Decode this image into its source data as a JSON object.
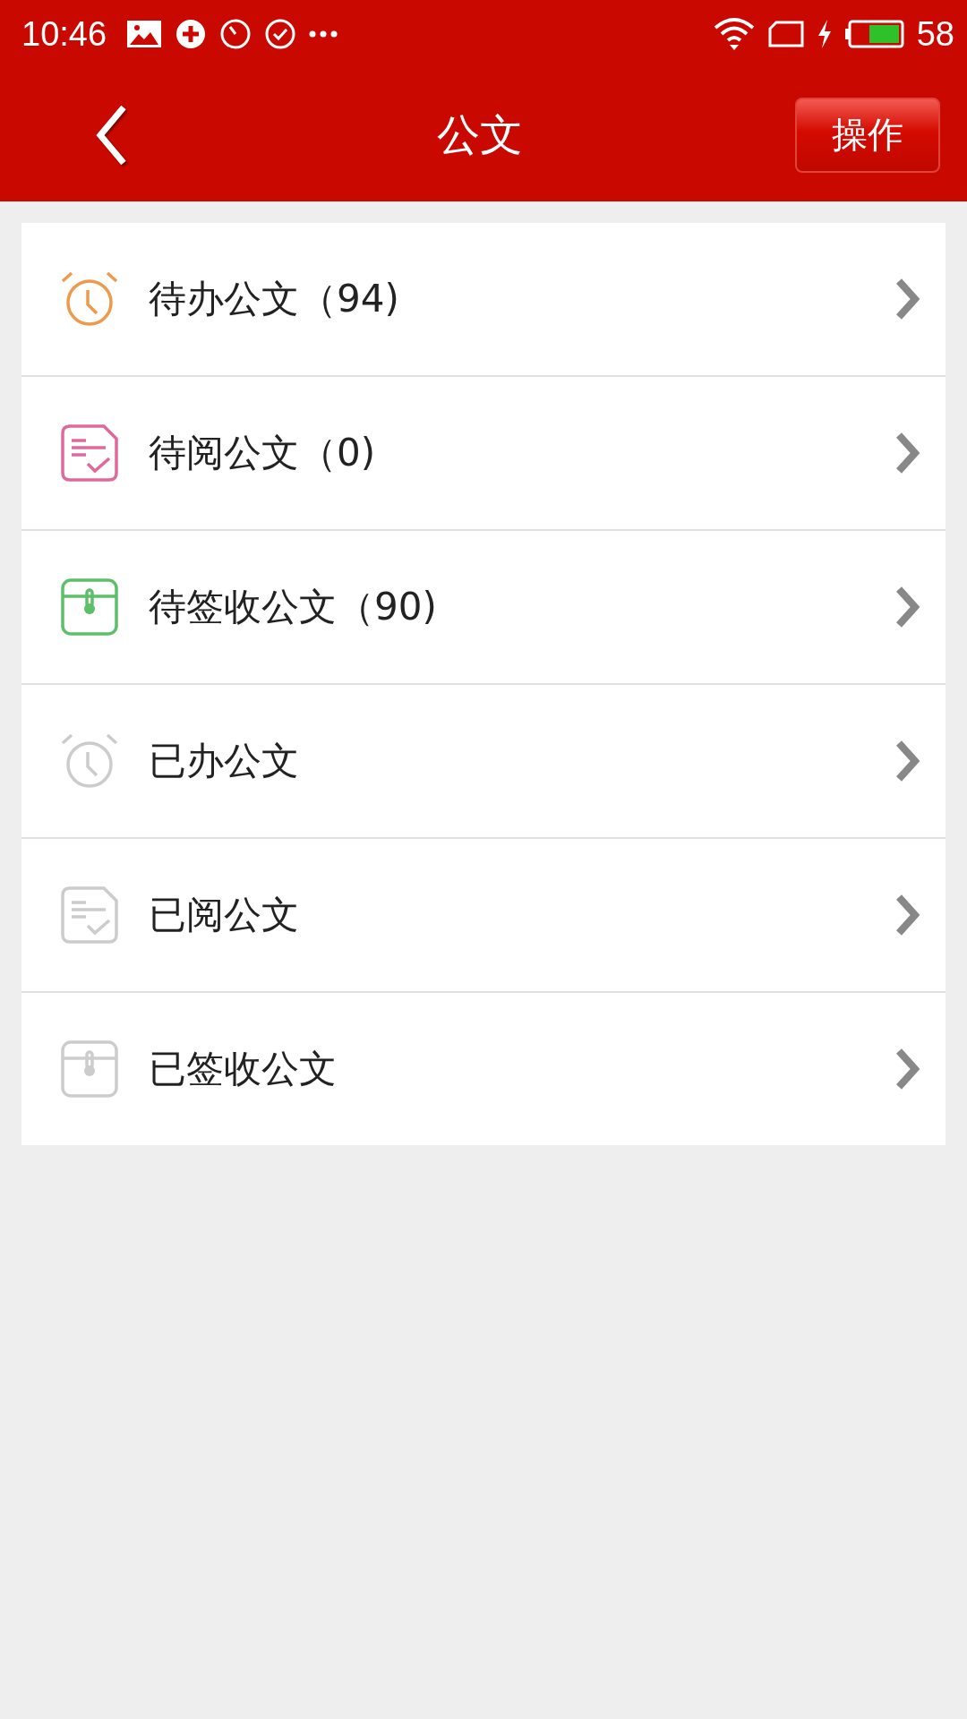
{
  "status_bar": {
    "time": "10:46",
    "battery": "58"
  },
  "header": {
    "title": "公文",
    "action": "操作"
  },
  "items": [
    {
      "kind": "alarm",
      "color": "#ee9a4d",
      "label": "待办公文（94)"
    },
    {
      "kind": "doc",
      "color": "#e0699c",
      "label": "待阅公文（0)"
    },
    {
      "kind": "box",
      "color": "#5dbf6a",
      "label": "待签收公文（90)"
    },
    {
      "kind": "alarm",
      "color": "#cccccc",
      "label": "已办公文"
    },
    {
      "kind": "doc",
      "color": "#cccccc",
      "label": "已阅公文"
    },
    {
      "kind": "box",
      "color": "#cccccc",
      "label": "已签收公文"
    }
  ]
}
